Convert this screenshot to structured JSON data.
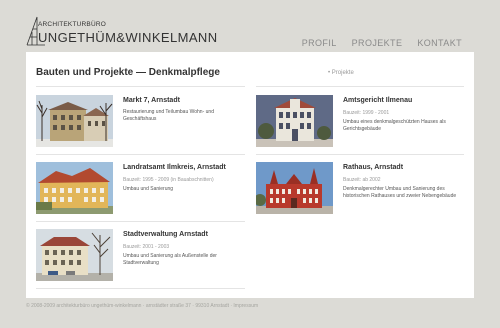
{
  "logo": {
    "small": "ARCHITEKTURBÜRO",
    "big": "UNGETHÜM&WINKELMANN"
  },
  "nav": [
    "PROFIL",
    "PROJEKTE",
    "KONTAKT"
  ],
  "page": {
    "title": "Bauten und Projekte — Denkmalpflege",
    "back_link": "• Projekte"
  },
  "projects": [
    {
      "title": "Markt 7, Arnstadt",
      "meta": "",
      "desc": "Restaurierung und Teilumbau Wohn- und Geschäftshaus"
    },
    {
      "title": "Amtsgericht Ilmenau",
      "meta": "Bauzeit: 1999 - 2001",
      "desc": "Umbau eines denkmalgeschützten Hauses als Gerichtsgebäude"
    },
    {
      "title": "Landratsamt Ilmkreis, Arnstadt",
      "meta": "Bauzeit: 1995 - 2009 (in Bauabschnitten)",
      "desc": "Umbau und Sanierung"
    },
    {
      "title": "Rathaus, Arnstadt",
      "meta": "Bauzeit: ab 2002",
      "desc": "Denkmalgerechter Umbau und Sanierung des historischen Rathauses und zweier Nebengebäude"
    },
    {
      "title": "Stadtverwaltung Arnstadt",
      "meta": "Bauzeit: 2001 - 2003",
      "desc": "Umbau und Sanierung als Außenstelle der Stadtverwaltung"
    }
  ],
  "footer": "© 2008-2009 architekturbüro ungethüm-winkelmann · arnstädter straße 37 · 99310 Arnstadt · Impressum"
}
